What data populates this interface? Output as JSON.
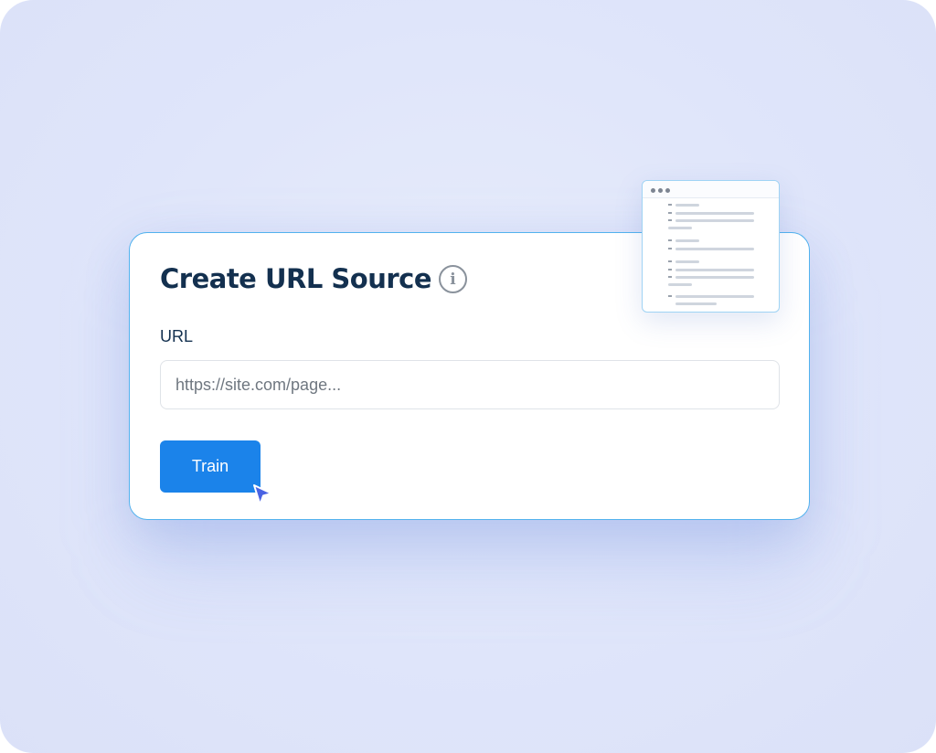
{
  "card": {
    "title": "Create URL Source",
    "info_icon": "info-icon",
    "url_label": "URL",
    "url_placeholder": "https://site.com/page...",
    "url_value": "",
    "train_label": "Train"
  },
  "icons": {
    "cursor": "cursor-arrow-icon"
  },
  "colors": {
    "accent": "#1b83ea",
    "title": "#13304f",
    "card_border": "#52b2ee",
    "background": "#dfe5fa"
  }
}
